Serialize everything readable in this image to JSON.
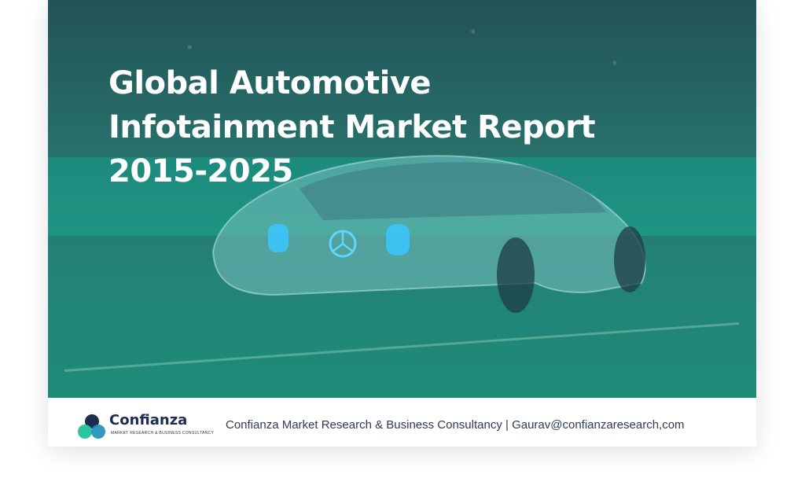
{
  "hero": {
    "title_lines": [
      "Global Automotive",
      "Infotainment Market Report",
      "2015-2025"
    ]
  },
  "footer": {
    "logo_name": "Confianza",
    "logo_tagline": "MARKET RESEARCH & BUSINESS CONSULTANCY",
    "contact_text": "Confianza Market Research & Business Consultancy | Gaurav@confianzaresearch,com"
  },
  "colors": {
    "overlay_teal": "#1f9a85",
    "logo_navy": "#1e2d4f",
    "logo_teal": "#2bc5a0",
    "logo_cyan": "#1f8fb8"
  },
  "icons": [
    "car-image",
    "logo-circles-icon"
  ]
}
